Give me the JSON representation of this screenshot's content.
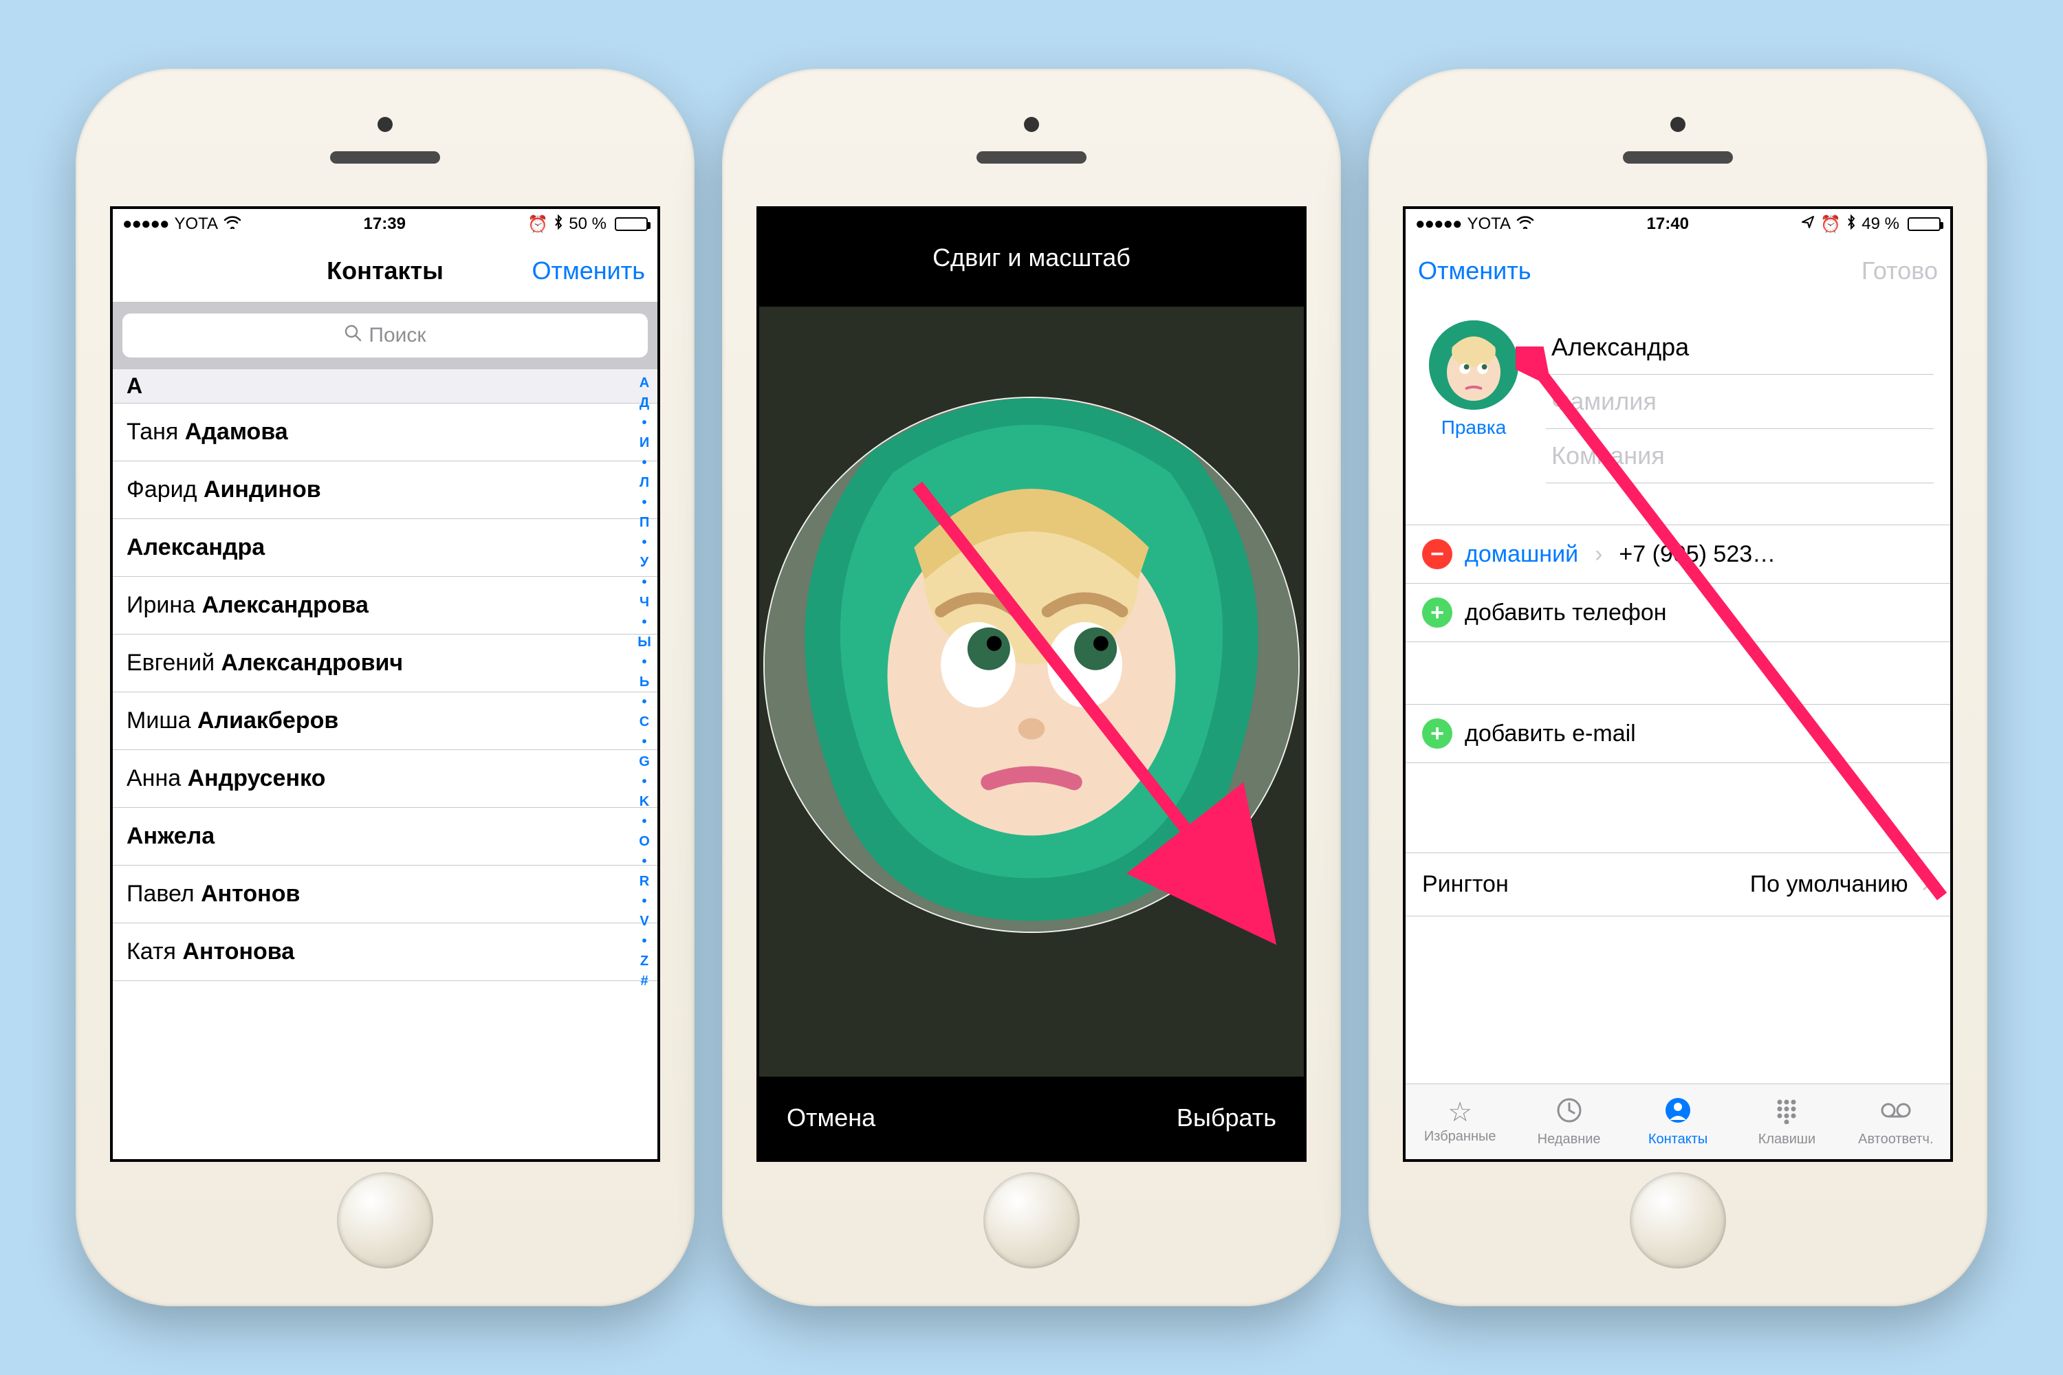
{
  "screen1": {
    "status": {
      "carrier": "YOTA",
      "time": "17:39",
      "battery_text": "50 %",
      "battery_pct": 50,
      "alarm": true,
      "bt": true
    },
    "nav": {
      "title": "Контакты",
      "cancel": "Отменить"
    },
    "search_placeholder": "Поиск",
    "section": "А",
    "contacts": [
      {
        "first": "Таня",
        "last": "Адамова"
      },
      {
        "first": "Фарид",
        "last": "Аиндинов"
      },
      {
        "single": "Александра"
      },
      {
        "first": "Ирина",
        "last": "Александрова"
      },
      {
        "first": "Евгений",
        "last": "Александрович"
      },
      {
        "first": "Миша",
        "last": "Алиакберов"
      },
      {
        "first": "Анна",
        "last": "Андрусенко"
      },
      {
        "single": "Анжела"
      },
      {
        "first": "Павел",
        "last": "Антонов"
      },
      {
        "first": "Катя",
        "last": "Антонова"
      }
    ],
    "index_rail": [
      "А",
      "Д",
      "•",
      "И",
      "•",
      "Л",
      "•",
      "П",
      "•",
      "У",
      "•",
      "Ч",
      "•",
      "Ы",
      "•",
      "Ь",
      "•",
      "C",
      "•",
      "G",
      "•",
      "K",
      "•",
      "O",
      "•",
      "R",
      "•",
      "V",
      "•",
      "Z",
      "#"
    ]
  },
  "screen2": {
    "title": "Сдвиг и масштаб",
    "cancel": "Отмена",
    "choose": "Выбрать"
  },
  "screen3": {
    "status": {
      "carrier": "YOTA",
      "time": "17:40",
      "battery_text": "49 %",
      "battery_pct": 49,
      "alarm": true,
      "bt": true,
      "nav": true
    },
    "nav": {
      "cancel": "Отменить",
      "done": "Готово"
    },
    "edit_photo": "Правка",
    "name": "Александра",
    "lastname_ph": "Фамилия",
    "company_ph": "Компания",
    "phone_label": "домашний",
    "phone_value": "+7 (905) 523…",
    "add_phone": "добавить телефон",
    "add_email": "добавить e-mail",
    "ringtone_label": "Рингтон",
    "ringtone_value": "По умолчанию",
    "tabs": {
      "favorites": "Избранные",
      "recents": "Недавние",
      "contacts": "Контакты",
      "keypad": "Клавиши",
      "voicemail": "Автоответч."
    }
  }
}
